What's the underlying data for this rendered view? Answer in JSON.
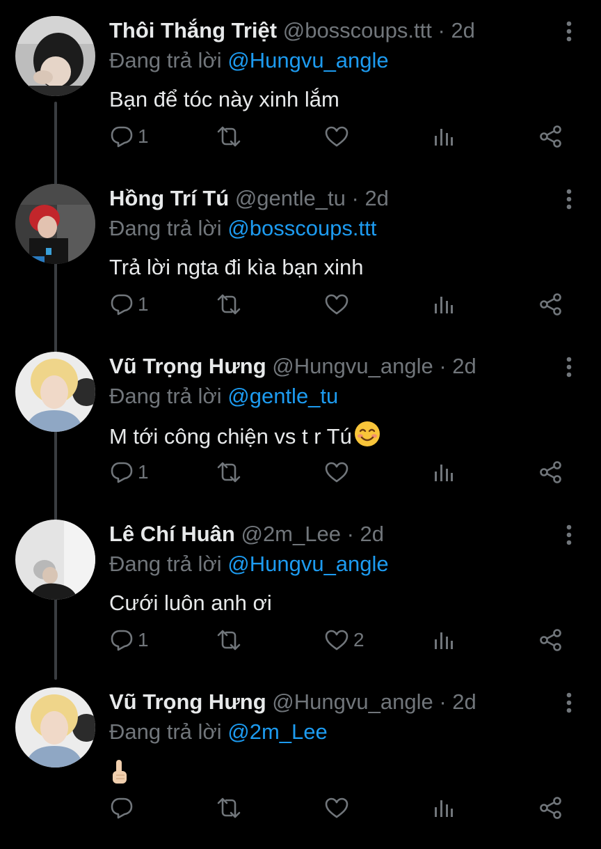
{
  "colors": {
    "background": "#000000",
    "text": "#e7e9ea",
    "muted": "#71767b",
    "link": "#1d9bf0",
    "thread_line": "#3a3d41"
  },
  "tweets": [
    {
      "name": "Thôi Thắng Triệt",
      "handle": "@bosscoups.ttt",
      "separator": "·",
      "time": "2d",
      "reply_prefix": "Đang trả lời",
      "reply_to": "@Hungvu_angle",
      "text": "Bạn để tóc này xinh lắm",
      "replies": "1",
      "retweets": "",
      "likes": "",
      "avatar_icon": "profile-photo-dark-hair"
    },
    {
      "name": "Hồng Trí Tú",
      "handle": "@gentle_tu",
      "separator": "·",
      "time": "2d",
      "reply_prefix": "Đang trả lời",
      "reply_to": "@bosscoups.ttt",
      "text": "Trả lời ngta đi kìa bạn xinh",
      "replies": "1",
      "retweets": "",
      "likes": "",
      "avatar_icon": "profile-photo-red-hair"
    },
    {
      "name": "Vũ Trọng Hưng",
      "handle": "@Hungvu_angle",
      "separator": "·",
      "time": "2d",
      "reply_prefix": "Đang trả lời",
      "reply_to": "@gentle_tu",
      "text": "M tới công chiện vs t r Tú",
      "text_emoji": "smiling-face-emoji",
      "replies": "1",
      "retweets": "",
      "likes": "",
      "avatar_icon": "profile-photo-blond-hair"
    },
    {
      "name": "Lê Chí Huân",
      "handle": "@2m_Lee",
      "separator": "·",
      "time": "2d",
      "reply_prefix": "Đang trả lời",
      "reply_to": "@Hungvu_angle",
      "text": "Cưới luôn anh ơi",
      "replies": "1",
      "retweets": "",
      "likes": "2",
      "avatar_icon": "profile-photo-grey"
    },
    {
      "name": "Vũ Trọng Hưng",
      "handle": "@Hungvu_angle",
      "separator": "·",
      "time": "2d",
      "reply_prefix": "Đang trả lời",
      "reply_to": "@2m_Lee",
      "text": "",
      "text_emoji": "pointing-up-emoji",
      "replies": "",
      "retweets": "",
      "likes": "",
      "avatar_icon": "profile-photo-blond-hair"
    }
  ]
}
